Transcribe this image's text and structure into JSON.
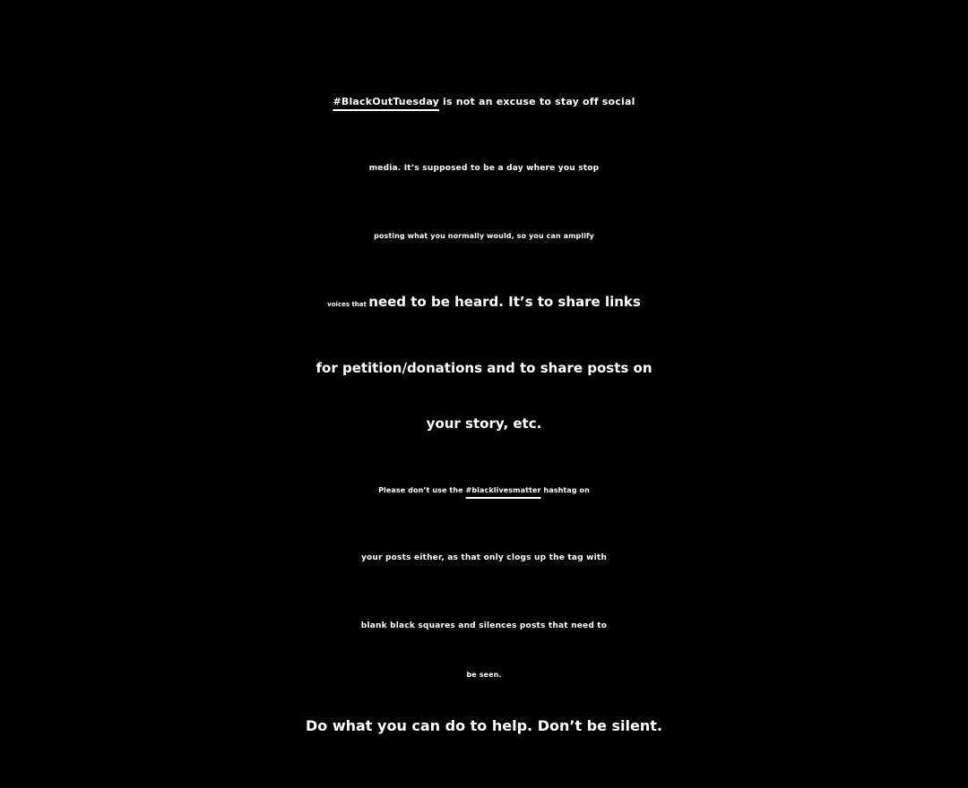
{
  "story": {
    "background_color": "#000000",
    "text_color": "#ffffff",
    "paragraph1": {
      "line1_tag": "#BlackOutTuesday",
      "line1_rest": " is not an excuse to stay off social",
      "line2": "media. It’s supposed to be a day where you stop",
      "line3": "posting what you normally would, so you can amplify",
      "line4_small": "voices that ",
      "line4_large": "need to be heard. It’s to share links",
      "line5": "for petition/donations and to share posts on",
      "line6": "your story, etc."
    },
    "paragraph2": {
      "line1_pre": "Please don’t use the ",
      "line1_tag": "#blacklivesmatter",
      "line1_post": " hashtag on",
      "line2": "your posts either, as that only clogs up the tag with",
      "line3": "blank black squares and silences posts that need to",
      "line4": "be seen."
    },
    "closing": "Do what you can do to help. Don’t be silent."
  }
}
